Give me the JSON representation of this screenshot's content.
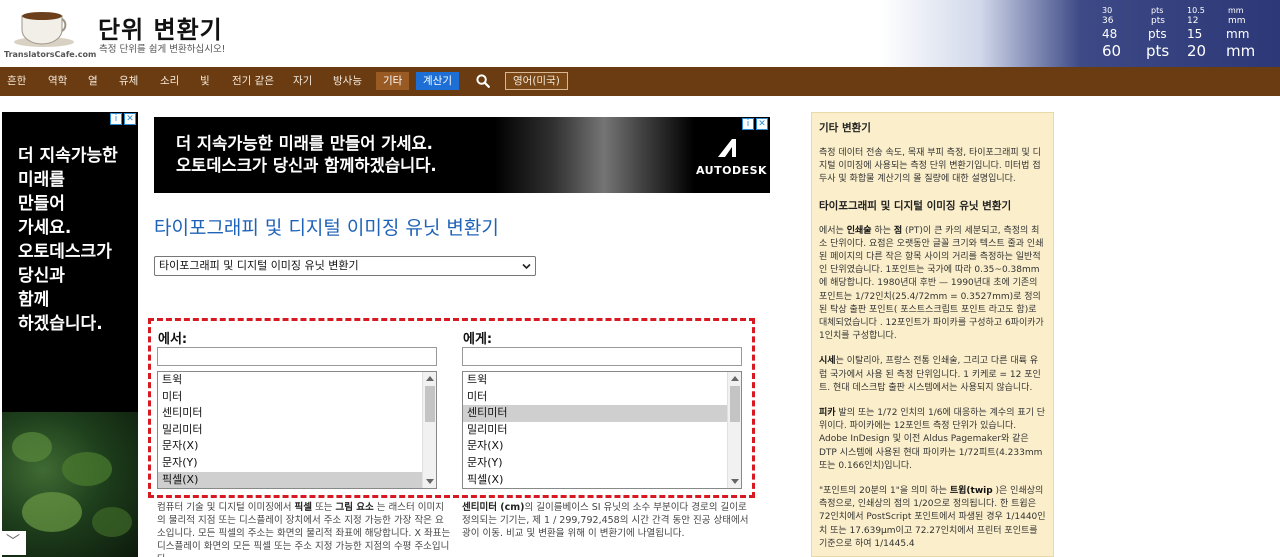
{
  "header": {
    "logo_brand": "TranslatorsCafe.com",
    "site_title": "단위 변환기",
    "site_subtitle": "측정 단위를 쉽게 변환하십시오!",
    "ruler": {
      "pts_rows": [
        "30",
        "36",
        "48",
        "60"
      ],
      "pts_label": "pts",
      "mm_rows": [
        "10.5",
        "12",
        "15",
        "20"
      ],
      "mm_label": "mm"
    }
  },
  "nav": {
    "items": [
      "흔한",
      "역학",
      "열",
      "유체",
      "소리",
      "빛",
      "전기 같은",
      "자기",
      "방사능"
    ],
    "other": "기타",
    "calculator": "계산기",
    "language": "영어(미국)",
    "search_icon": "search-icon"
  },
  "left_ad": {
    "text": "더 지속가능한\n미래를\n만들어\n가세요.\n오토데스크가\n당신과\n함께\n하겠습니다."
  },
  "top_ad": {
    "text": "더 지속가능한 미래를 만들어 가세요.\n오토데스크가 당신과 함께하겠습니다.",
    "brand": "AUTODESK"
  },
  "main": {
    "title": "타이포그래피 및 디지털 이미징 유닛 변환기",
    "category_select": "타이포그래피 및 디지털 이미징 유닛 변환기"
  },
  "from": {
    "label": "에서:",
    "filter_value": "",
    "units": [
      "트윅",
      "미터",
      "센티미터",
      "밀리미터",
      "문자(X)",
      "문자(Y)",
      "픽셀(X)"
    ],
    "selected": "픽셀(X)"
  },
  "to": {
    "label": "에게:",
    "filter_value": "",
    "units": [
      "트윅",
      "미터",
      "센티미터",
      "밀리미터",
      "문자(X)",
      "문자(Y)",
      "픽셀(X)"
    ],
    "selected": "센티미터"
  },
  "descriptions": {
    "from_pre": "컴퓨터 기술 및 디지털 이미징에서 ",
    "from_b1": "픽셀",
    "from_mid": " 또는 ",
    "from_b2": "그림 요소",
    "from_post": " 는 래스터 이미지의 물리적 지점 또는 디스플레이 장치에서 주소 지정 가능한 가장 작은 요소입니다. 모든 픽셀의 주소는 화면의 물리적 좌표에 해당합니다. X 좌표는 디스플레이 화면의 모든 픽셀 또는 주소 지정 가능한 지점의 수평 주소입니다.",
    "to_b": "센티미터 (cm)",
    "to_post": "의 길이를베이스 SI 유닛의 소수 부분이다 경로의 길이로 정의되는 기기는, 제 1 / 299,792,458의 시간 간격 동안 진공 상태에서 광이 이동. 비교 및 변환을 위해 이 변환기에 나열됩니다."
  },
  "sidebar": {
    "heading1": "기타 변환기",
    "p1": "측정 데이터 전송 속도, 목재 부피 측정, 타이포그래피 및 디지털 이미징에 사용되는 측정 단위 변환기입니다. 미터법 접두사 및 화합물 계산기의 몰 질량에 대한 설명입니다.",
    "heading2": "타이포그래피 및 디지털 이미징 유닛 변환기",
    "p2_pre": "에서는 ",
    "p2_b1": "인쇄술",
    "p2_mid1": " 하는 ",
    "p2_b2": "점",
    "p2_post": " (PT)이 큰 카의 세분되고, 측정의 최소 단위이다. 요점은 오랫동안 글꼴 크기와 텍스트 줄과 인쇄된 페이지의 다른 작은 항목 사이의 거리를 측정하는 일반적인 단위였습니다. 1포인트는 국가에 따라 0.35~0.38mm에 해당합니다. 1980년대 후반 — 1990년대 초에 기존의 포인트는 1/72인치(25.4/72mm = 0.3527mm)로 정의된 탁상 출판 포인트( 포스트스크립트 포인트 라고도 함)로 대체되었습니다 . 12포인트가 파이카를 구성하고 6파이카가 1인치를 구성합니다.",
    "p3_b": "시세",
    "p3_post": "는 이탈리아, 프랑스 전통 인쇄술, 그리고 다른 대륙 유럽 국가에서 사용 된 측정 단위입니다. 1 키케로 = 12 포인트. 현대 데스크탑 출판 시스템에서는 사용되지 않습니다.",
    "p4_b": "피카",
    "p4_post": " 발의 또는 1/72 인치의 1/6에 대응하는 계수의 표기 단위이다. 파이카에는 12포인트 측정 단위가 있습니다. Adobe InDesign 및 이전 Aldus Pagemaker와 같은 DTP 시스템에 사용된 현대 파이카는 1/72피트(4.233mm 또는 0.166인치)입니다.",
    "p5_pre": "\"포인트의 20분의 1\"을 의미 하는 ",
    "p5_b": "트윕(twip",
    "p5_post": " )은 인쇄상의 측정으로, 인쇄상의 점의 1/20으로 정의됩니다. 한 트윕은 72인치에서 PostScript 포인트에서 파생된 경우 1/1440인치 또는 17.639μm이고 72.27인치에서 프린터 포인트를 기준으로 하여 1/1445.4"
  }
}
